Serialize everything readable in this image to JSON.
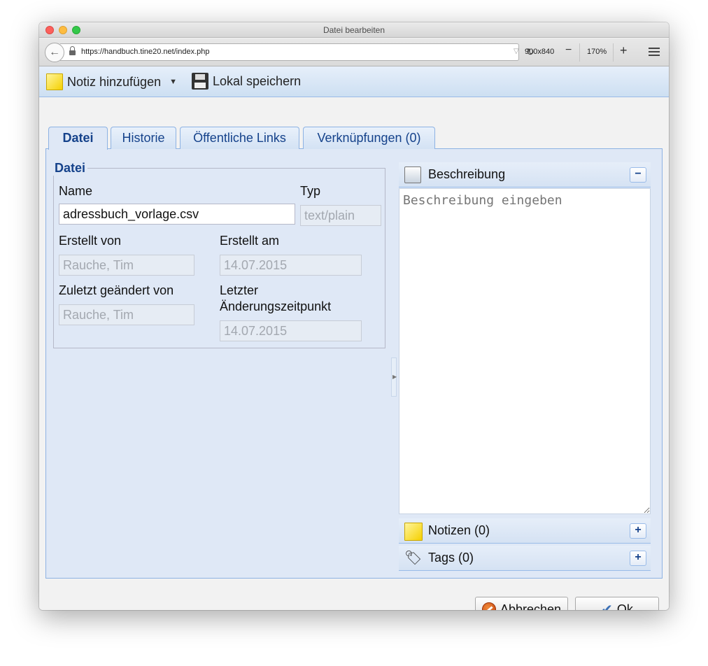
{
  "window": {
    "title": "Datei bearbeiten"
  },
  "browser": {
    "url": "https://handbuch.tine20.net/index.php",
    "viewport_size": "900x840",
    "zoom_level": "170%",
    "zoom_minus": "−",
    "zoom_plus": "+",
    "back_label": "←",
    "reload_label": "↻",
    "dropdown_label": "▽"
  },
  "toolbar": {
    "add_note_label": "Notiz hinzufügen",
    "add_note_arrow": "▼",
    "save_local_label": "Lokal speichern"
  },
  "tabs": [
    {
      "label": "Datei",
      "active": true
    },
    {
      "label": "Historie"
    },
    {
      "label": "Öffentliche Links"
    },
    {
      "label": "Verknüpfungen (0)"
    }
  ],
  "file_section": {
    "legend": "Datei",
    "name_label": "Name",
    "name_value": "adressbuch_vorlage.csv",
    "type_label": "Typ",
    "type_value": "text/plain",
    "created_by_label": "Erstellt von",
    "created_by_value": "Rauche, Tim",
    "created_at_label": "Erstellt am",
    "created_at_value": "14.07.2015",
    "modified_by_label": "Zuletzt geändert von",
    "modified_by_value": "Rauche, Tim",
    "modified_at_label_line1": "Letzter",
    "modified_at_label_line2": "Änderungszeitpunkt",
    "modified_at_value": "14.07.2015"
  },
  "description": {
    "title": "Beschreibung",
    "toggle": "−",
    "placeholder": "Beschreibung eingeben"
  },
  "notes": {
    "title": "Notizen (0)",
    "toggle": "+"
  },
  "tags": {
    "title": "Tags (0)",
    "toggle": "+"
  },
  "footer": {
    "cancel_label": "Abbrechen",
    "ok_label": "Ok",
    "ok_icon": "✔"
  }
}
